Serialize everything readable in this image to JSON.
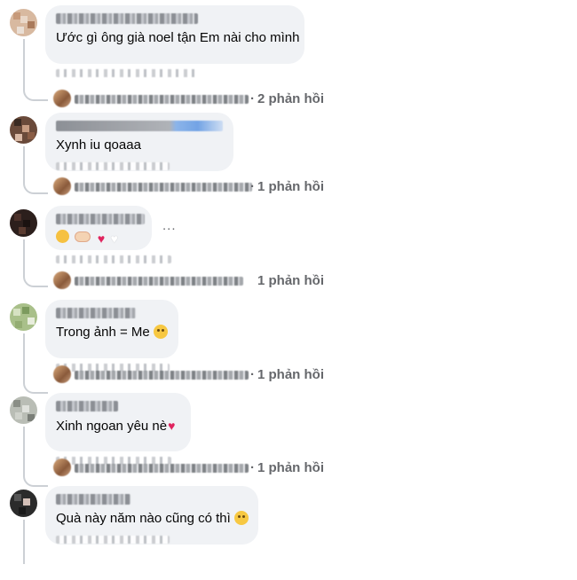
{
  "comments": [
    {
      "text": "Ước gì ông già noel tận Em nài cho mình",
      "reply_count": "2 phản hồi",
      "reply_prefix": "·"
    },
    {
      "text": "Xynh iu qoaaa",
      "reply_count": "1 phản hồi",
      "reply_prefix": "·"
    },
    {
      "text": "",
      "reply_count": "1 phản hồi",
      "reply_prefix": "",
      "more_label": "..."
    },
    {
      "text": "Trong ảnh = Me",
      "reply_count": "1 phản hồi",
      "reply_prefix": "·"
    },
    {
      "text": "Xinh ngoan yêu nè",
      "reply_count": "1 phản hồi",
      "reply_prefix": "·"
    },
    {
      "text": "Quà này năm nào cũng có thì",
      "reply_count": "",
      "reply_prefix": ""
    }
  ],
  "colors": {
    "bubble": "#f0f2f5",
    "secondary_text": "#65676b",
    "thread_line": "#ccd0d5",
    "heart": "#e0245e"
  }
}
